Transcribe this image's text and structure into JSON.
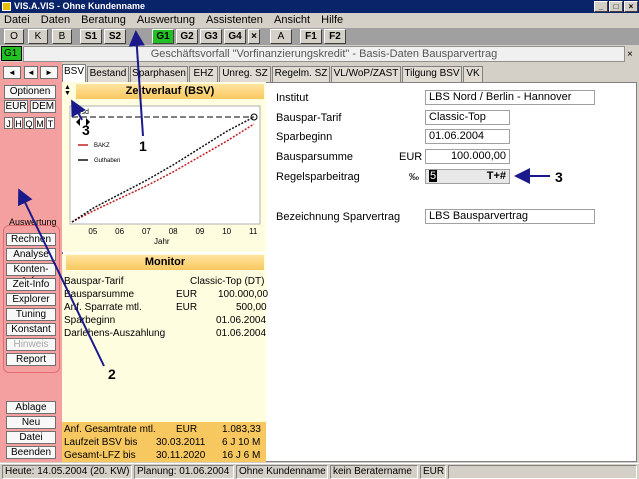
{
  "window": {
    "title": "VIS.A.VIS - Ohne Kundenname",
    "minimize": "_",
    "maximize": "□",
    "close": "×"
  },
  "menu": [
    "Datei",
    "Daten",
    "Beratung",
    "Auswertung",
    "Assistenten",
    "Ansicht",
    "Hilfe"
  ],
  "toolbar": [
    "O",
    "K",
    "B",
    "S1",
    "S2",
    "G1",
    "G2",
    "G3",
    "G4",
    "×",
    "A",
    "F1",
    "F2"
  ],
  "header": {
    "badge": "G1",
    "title": "Geschäftsvorfall \"Vorfinanzierungskredit\" - Basis-Daten Bausparvertrag",
    "close": "×"
  },
  "sidebar": {
    "nav_left": "◄",
    "nav_right": "►",
    "options": "Optionen",
    "eur": "EUR",
    "dem": "DEM",
    "period": [
      "J",
      "H",
      "Q",
      "M",
      "T"
    ],
    "section_label": "Auswertung",
    "buttons": [
      "Rechnen",
      "Analyse",
      "Konten-Info",
      "Zeit-Info",
      "Explorer",
      "Tuning",
      "Konstant",
      "Hinweis",
      "Report"
    ],
    "bottom_buttons": [
      "Ablage",
      "Neu",
      "Datei",
      "Beenden"
    ]
  },
  "tabs": [
    "BSV",
    "Bestand",
    "Sparphasen",
    "EHZ",
    "Unreg. SZ",
    "Regelm. SZ",
    "VL/WoP/ZAST",
    "Tilgung BSV",
    "VK"
  ],
  "chart_panel": {
    "title": "Zeitverlauf (BSV)",
    "legend": [
      "BAKZ",
      "Guthaben"
    ],
    "ylabel_top": "Tsd",
    "xlabel": "Jahr",
    "colors": {
      "bakz": "#c02020",
      "guthaben": "#101010",
      "limit": "#000000"
    }
  },
  "chart_data": {
    "type": "line",
    "xlabel": "Jahr",
    "ylabel": "Tsd",
    "x_ticks": [
      "05",
      "06",
      "07",
      "08",
      "09",
      "10",
      "11"
    ],
    "x": [
      4.2,
      5,
      6,
      7,
      8,
      9,
      10,
      11
    ],
    "series": [
      {
        "name": "BAKZ",
        "values": [
          0,
          8,
          17,
          26,
          36,
          47,
          58,
          70
        ]
      },
      {
        "name": "Guthaben",
        "values": [
          0,
          10,
          20,
          30,
          41,
          53,
          65,
          75
        ]
      }
    ],
    "reference_line": 75,
    "xlim": [
      4.2,
      11
    ],
    "ylim": [
      0,
      80
    ],
    "grid": false,
    "legend_position": "left"
  },
  "monitor": {
    "title": "Monitor",
    "rows": [
      {
        "label": "Bauspar-Tarif",
        "unit": "",
        "value": "Classic-Top  (DT)"
      },
      {
        "label": "Bausparsumme",
        "unit": "EUR",
        "value": "100.000,00"
      },
      {
        "label": "Anf. Sparrate mtl.",
        "unit": "EUR",
        "value": "500,00"
      },
      {
        "label": "Sparbeginn",
        "unit": "",
        "value": "01.06.2004"
      },
      {
        "label": "Darlehens-Auszahlung",
        "unit": "",
        "value": "01.06.2004"
      }
    ],
    "summary": [
      {
        "label": "Anf. Gesamtrate mtl.",
        "mid": "EUR",
        "value": "1.083,33"
      },
      {
        "label": "Laufzeit BSV bis",
        "mid": "30.03.2011",
        "value": "6 J 10 M"
      },
      {
        "label": "Gesamt-LFZ bis",
        "mid": "30.11.2020",
        "value": "16 J 6 M"
      }
    ]
  },
  "form": {
    "institut_label": "Institut",
    "institut_value": "LBS Nord / Berlin - Hannover",
    "tarif_label": "Bauspar-Tarif",
    "tarif_value": "Classic-Top",
    "beginn_label": "Sparbeginn",
    "beginn_value": "01.06.2004",
    "summe_label": "Bausparsumme",
    "summe_unit": "EUR",
    "summe_value": "100.000,00",
    "regel_label": "Regelsparbeitrag",
    "regel_unit": "‰",
    "regel_value": "5",
    "regel_suffix": "T+#",
    "bez_label": "Bezeichnung Sparvertrag",
    "bez_value": "LBS Bausparvertrag"
  },
  "callouts": [
    "1",
    "2",
    "3",
    "3"
  ],
  "statusbar": [
    "Heute: 14.05.2004 (20. KW)",
    "Planung: 01.06.2004",
    "Ohne Kundenname",
    "kein Beratername",
    "EUR"
  ]
}
